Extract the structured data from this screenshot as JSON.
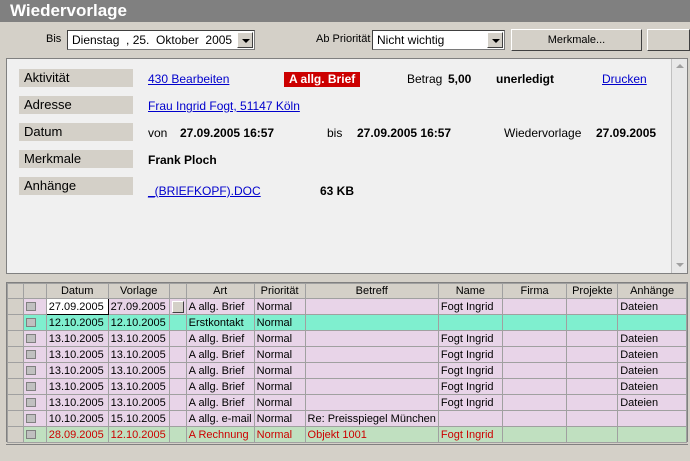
{
  "window": {
    "title": "Wiedervorlage"
  },
  "toolbar": {
    "bis_label": "Bis",
    "bis_value": "Dienstag  , 25.  Oktober  2005",
    "prioritaet_label": "Ab Priorität",
    "prioritaet_value": "Nicht wichtig",
    "merkmale_button": "Merkmale..."
  },
  "detail": {
    "aktivitaet_label": "Aktivität",
    "aktivitaet_link": "430  Bearbeiten",
    "art_badge": "A allg. Brief",
    "betrag_label": "Betrag",
    "betrag_value": "5,00",
    "status": "unerledigt",
    "drucken_link": "Drucken",
    "adresse_label": "Adresse",
    "adresse_link": "Frau Ingrid Fogt,  51147 Köln",
    "datum_label": "Datum",
    "von_label": "von",
    "von_value": "27.09.2005 16:57",
    "bis_label": "bis",
    "bis_value": "27.09.2005 16:57",
    "wiedervorlage_label": "Wiedervorlage",
    "wiedervorlage_value": "27.09.2005",
    "merkmale_label": "Merkmale",
    "merkmale_value": "Frank Ploch",
    "anhaenge_label": "Anhänge",
    "anhang_link": "_(BRIEFKOPF).DOC",
    "anhang_size": "63 KB"
  },
  "grid": {
    "columns": [
      "Datum",
      "Vorlage",
      "Art",
      "Priorität",
      "Betreff",
      "Name",
      "Firma",
      "Projekte",
      "Anhänge"
    ],
    "rows": [
      {
        "datum": "27.09.2005",
        "vorlage": "27.09.2005",
        "art": "A allg. Brief",
        "prioritaet": "Normal",
        "betreff": "",
        "name": "Fogt Ingrid",
        "firma": "",
        "projekte": "",
        "anhaenge": "Dateien",
        "style": "pink"
      },
      {
        "datum": "12.10.2005",
        "vorlage": "12.10.2005",
        "art": "Erstkontakt",
        "prioritaet": "Normal",
        "betreff": "",
        "name": "",
        "firma": "",
        "projekte": "",
        "anhaenge": "",
        "style": "cyan"
      },
      {
        "datum": "13.10.2005",
        "vorlage": "13.10.2005",
        "art": "A allg. Brief",
        "prioritaet": "Normal",
        "betreff": "",
        "name": "Fogt Ingrid",
        "firma": "",
        "projekte": "",
        "anhaenge": "Dateien",
        "style": "pink"
      },
      {
        "datum": "13.10.2005",
        "vorlage": "13.10.2005",
        "art": "A allg. Brief",
        "prioritaet": "Normal",
        "betreff": "",
        "name": "Fogt Ingrid",
        "firma": "",
        "projekte": "",
        "anhaenge": "Dateien",
        "style": "pink"
      },
      {
        "datum": "13.10.2005",
        "vorlage": "13.10.2005",
        "art": "A allg. Brief",
        "prioritaet": "Normal",
        "betreff": "",
        "name": "Fogt Ingrid",
        "firma": "",
        "projekte": "",
        "anhaenge": "Dateien",
        "style": "pink"
      },
      {
        "datum": "13.10.2005",
        "vorlage": "13.10.2005",
        "art": "A allg. Brief",
        "prioritaet": "Normal",
        "betreff": "",
        "name": "Fogt Ingrid",
        "firma": "",
        "projekte": "",
        "anhaenge": "Dateien",
        "style": "pink"
      },
      {
        "datum": "13.10.2005",
        "vorlage": "13.10.2005",
        "art": "A allg. Brief",
        "prioritaet": "Normal",
        "betreff": "",
        "name": "Fogt Ingrid",
        "firma": "",
        "projekte": "",
        "anhaenge": "Dateien",
        "style": "pink"
      },
      {
        "datum": "10.10.2005",
        "vorlage": "15.10.2005",
        "art": "A allg. e-mail",
        "prioritaet": "Normal",
        "betreff": "Re: Preisspiegel München",
        "name": "",
        "firma": "",
        "projekte": "",
        "anhaenge": "",
        "style": "pink"
      },
      {
        "datum": "28.09.2005",
        "vorlage": "12.10.2005",
        "art": "A Rechnung",
        "prioritaet": "Normal",
        "betreff": "Objekt 1001",
        "name": "Fogt Ingrid",
        "firma": "",
        "projekte": "",
        "anhaenge": "",
        "style": "green"
      }
    ]
  },
  "colors": {
    "title_bar": "#808080",
    "badge": "#cc0000",
    "row_pink": "#e8d4e8",
    "row_cyan": "#7fefcf",
    "row_green": "#c0e0c0"
  }
}
